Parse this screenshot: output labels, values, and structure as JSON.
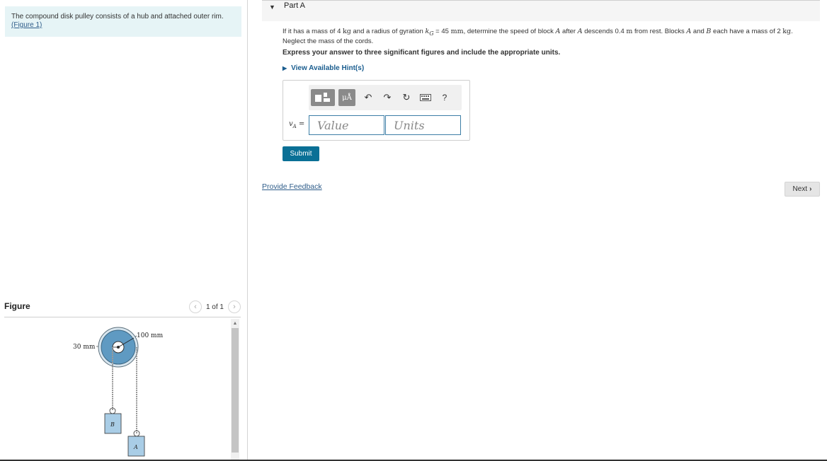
{
  "intro": {
    "text": "The compound disk pulley consists of a hub and attached outer rim.",
    "figure_link": "(Figure 1)"
  },
  "figure_panel": {
    "title": "Figure",
    "pager_text": "1 of 1",
    "prev_icon": "chevron-left-icon",
    "next_icon": "chevron-right-icon",
    "diagram": {
      "label_outer": "100 mm",
      "label_inner": "30 mm",
      "block_b": "B",
      "block_a": "A"
    }
  },
  "part": {
    "title": "Part A",
    "caret_icon": "caret-down-icon"
  },
  "question": {
    "t1": "If it has a mass of 4 ",
    "u1": "kg",
    "t2": " and a radius of gyration ",
    "k_sym": "k",
    "k_sub": "G",
    "t3": " = 45 ",
    "u2": "mm",
    "t4": ", determine the speed of block ",
    "a1": "A",
    "t5": " after ",
    "a2": "A",
    "t6": " descends 0.4 ",
    "u3": "m",
    "t7": " from rest. Blocks ",
    "a3": "A",
    "t8": " and ",
    "b1": "B",
    "t9": " each have a mass of 2 ",
    "u4": "kg",
    "t10": ".",
    "line2": "Neglect the mass of the cords."
  },
  "instruction": "Express your answer to three significant figures and include the appropriate units.",
  "hint_link": "View Available Hint(s)",
  "toolbar": {
    "mu_label": "μÅ",
    "undo_icon": "undo-icon",
    "redo_icon": "redo-icon",
    "reset_icon": "reset-icon",
    "keyboard_icon": "keyboard-icon",
    "help_label": "?"
  },
  "answer": {
    "var_symbol": "v",
    "var_sub": "A",
    "eq": " =",
    "value_placeholder": "Value",
    "units_placeholder": "Units"
  },
  "submit_label": "Submit",
  "feedback_label": "Provide Feedback",
  "next_label": "Next",
  "colors": {
    "accent": "#0a7096",
    "link": "#2f5d8a",
    "intro_bg": "#e6f4f6",
    "pulley_outer": "#8fbad6",
    "pulley_inner": "#3f7fa9"
  }
}
